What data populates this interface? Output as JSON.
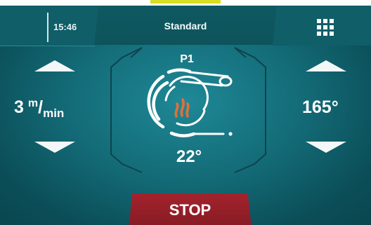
{
  "status_bar": {
    "time": "15:46",
    "mode": "Standard",
    "menu_icon": "grid-menu-icon"
  },
  "left_panel": {
    "value": "3",
    "unit_numerator": "m",
    "unit_slash": "/",
    "unit_denominator": "min",
    "increase_icon": "arrow-up-icon",
    "decrease_icon": "arrow-down-icon"
  },
  "center_panel": {
    "program": "P1",
    "temperature": "22°",
    "status_icon": "spool-heating-icon"
  },
  "right_panel": {
    "value": "165°",
    "increase_icon": "arrow-up-icon",
    "decrease_icon": "arrow-down-icon"
  },
  "actions": {
    "stop_label": "STOP"
  },
  "colors": {
    "background": "#136b77",
    "stop_button": "#9a1f29",
    "flame": "#e2703a",
    "text": "#ffffff"
  }
}
